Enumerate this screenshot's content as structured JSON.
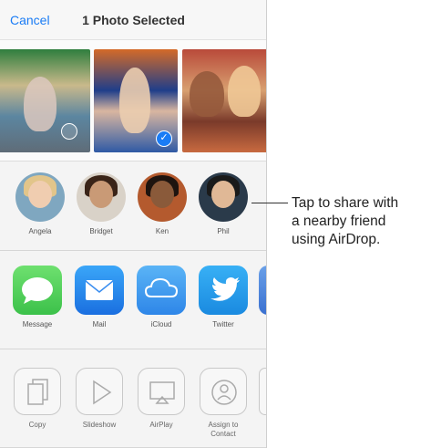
{
  "navbar": {
    "cancel_label": "Cancel",
    "title": "1 Photo Selected"
  },
  "photos": [
    {
      "selected": false
    },
    {
      "selected": true
    },
    {
      "selected": false
    }
  ],
  "airdrop_people": [
    {
      "name": "Angela"
    },
    {
      "name": "Bridget"
    },
    {
      "name": "Ken"
    },
    {
      "name": "Phil"
    }
  ],
  "share_apps": [
    {
      "label": "Message",
      "icon": "message-icon",
      "color": "#4cd964"
    },
    {
      "label": "Mail",
      "icon": "mail-icon",
      "color": "#1f8ef1"
    },
    {
      "label": "iCloud",
      "icon": "icloud-icon",
      "color": "#3a9cf2"
    },
    {
      "label": "Twitter",
      "icon": "twitter-icon",
      "color": "#1d9bf0"
    }
  ],
  "actions": [
    {
      "label": "Copy",
      "icon": "copy-icon"
    },
    {
      "label": "Slideshow",
      "icon": "slideshow-icon"
    },
    {
      "label": "AirPlay",
      "icon": "airplay-icon"
    },
    {
      "label": "Assign to Contact",
      "icon": "assign-contact-icon"
    }
  ],
  "callout": {
    "line1": "Tap to share with",
    "line2": "a nearby friend",
    "line3": "using AirDrop."
  },
  "colors": {
    "accent": "#1a7cf5"
  }
}
